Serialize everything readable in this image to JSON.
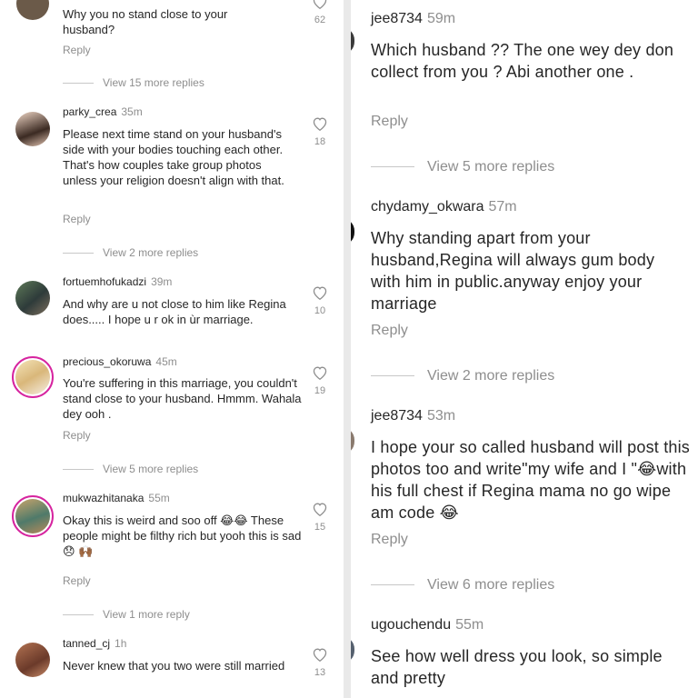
{
  "left": {
    "comments": [
      {
        "user": "",
        "time": "",
        "text": "Why you no stand close to your husband?",
        "reply": "Reply",
        "likes": "62",
        "more": "View 15 more replies"
      },
      {
        "user": "parky_crea",
        "time": "35m",
        "text": "Please next time stand on your husband's side with your bodies touching each other. That's how couples take group photos unless your religion doesn't align with that.",
        "reply": "Reply",
        "likes": "18",
        "more": "View 2 more replies"
      },
      {
        "user": "fortuemhofukadzi",
        "time": "39m",
        "text": "And why are u not close to him like Regina does..... I hope u r ok in ùr marriage.",
        "reply": "",
        "likes": "10",
        "more": ""
      },
      {
        "user": "precious_okoruwa",
        "time": "45m",
        "text": "You're suffering in this marriage, you couldn't stand close to your husband. Hmmm. Wahala dey ooh .",
        "reply": "Reply",
        "likes": "19",
        "more": "View 5 more replies"
      },
      {
        "user": "mukwazhitanaka",
        "time": "55m",
        "text": "Okay this is weird and soo off 😂😂 These people might be filthy rich but yooh this is sad 😞 🙌🏾",
        "reply": "Reply",
        "likes": "15",
        "more": "View 1 more reply"
      },
      {
        "user": "tanned_cj",
        "time": "1h",
        "text": "Never knew that you two were still married",
        "reply": "",
        "likes": "13",
        "more": ""
      }
    ]
  },
  "right": {
    "comments": [
      {
        "user": "jee8734",
        "time": "59m",
        "text": "Which husband ?? The one wey dey don collect from you ? Abi another one .",
        "reply": "Reply",
        "more": "View 5 more replies"
      },
      {
        "user": "chydamy_okwara",
        "time": "57m",
        "text": "Why standing apart from your husband,Regina will always gum body with him in public.anyway enjoy your marriage",
        "reply": "Reply",
        "more": "View 2 more replies"
      },
      {
        "user": "jee8734",
        "time": "53m",
        "text": "I hope your so called husband will post this photos too and write\"my wife and I \"😂with his full chest if Regina mama no go wipe am code 😂",
        "reply": "Reply",
        "more": "View 6 more replies"
      },
      {
        "user": "ugouchendu",
        "time": "55m",
        "text": "See how well dress you look, so simple and pretty",
        "reply": "",
        "more": ""
      }
    ]
  },
  "icons": {
    "heart": "heart-outline-icon"
  },
  "colors": {
    "ring": "#d6249f",
    "muted": "#8e8e8e",
    "text": "#262626"
  }
}
